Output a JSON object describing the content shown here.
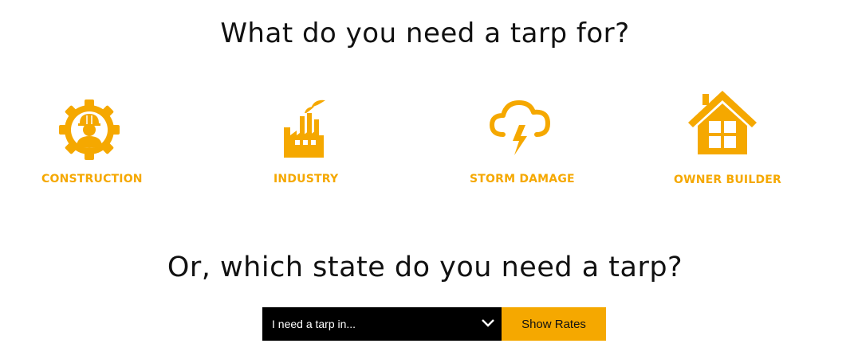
{
  "headings": {
    "primary": "What do you need a tarp for?",
    "secondary": "Or, which state do you need a tarp?"
  },
  "categories": [
    {
      "label": "CONSTRUCTION",
      "icon": "gear-worker-icon"
    },
    {
      "label": "INDUSTRY",
      "icon": "factory-icon"
    },
    {
      "label": "STORM DAMAGE",
      "icon": "storm-cloud-icon"
    },
    {
      "label": "OWNER BUILDER",
      "icon": "house-icon"
    }
  ],
  "state_form": {
    "select_value": "I need a tarp in...",
    "button_label": "Show Rates"
  },
  "colors": {
    "accent": "#f5a800",
    "select_background": "#000000",
    "text": "#111111"
  }
}
